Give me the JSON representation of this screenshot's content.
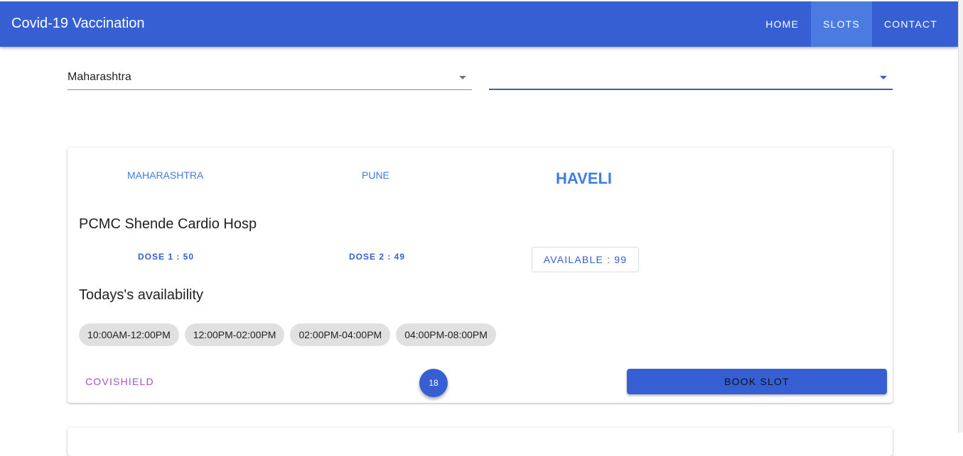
{
  "app": {
    "title": "Covid-19 Vaccination"
  },
  "nav": {
    "items": [
      "HOME",
      "SLOTS",
      "CONTACT"
    ],
    "active": "SLOTS"
  },
  "filters": {
    "state": "Maharashtra",
    "district": ""
  },
  "center": {
    "state": "MAHARASHTRA",
    "district": "PUNE",
    "block": "HAVELI",
    "name": "PCMC Shende Cardio Hosp",
    "dose1": "DOSE 1 : 50",
    "dose2": "DOSE 2 : 49",
    "available": "AVAILABLE : 99",
    "availability_heading": "Todays's availability",
    "slots": [
      "10:00AM-12:00PM",
      "12:00PM-02:00PM",
      "02:00PM-04:00PM",
      "04:00PM-08:00PM"
    ],
    "vaccine": "COVISHIELD",
    "min_age": "18",
    "book_label": "BOOK SLOT"
  },
  "colors": {
    "primary": "#365fd4",
    "accent": "#3f7de0",
    "vaccine": "#a552c9"
  }
}
